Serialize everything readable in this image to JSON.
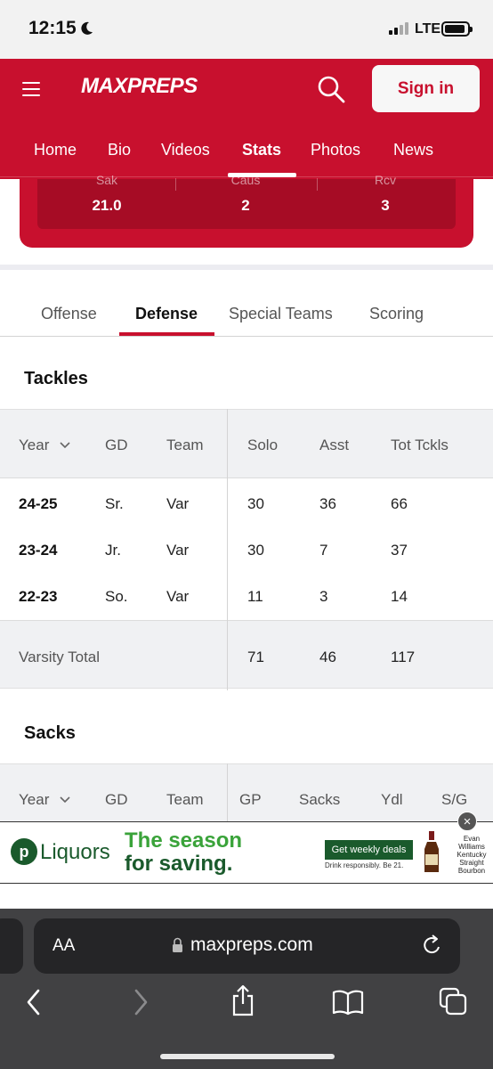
{
  "status_bar": {
    "time": "12:15",
    "network": "LTE"
  },
  "header": {
    "logo": "MAXPREPS",
    "signin_label": "Sign in",
    "nav": [
      "Home",
      "Bio",
      "Videos",
      "Stats",
      "Photos",
      "News"
    ],
    "active_nav": "Stats"
  },
  "summary": {
    "stats": [
      {
        "label": "Sak",
        "value": "21.0"
      },
      {
        "label": "Caus",
        "value": "2"
      },
      {
        "label": "Rcv",
        "value": "3"
      }
    ]
  },
  "subtabs": {
    "items": [
      "Offense",
      "Defense",
      "Special Teams",
      "Scoring"
    ],
    "active": "Defense"
  },
  "tackles": {
    "title": "Tackles",
    "columns": [
      "Year",
      "GD",
      "Team",
      "Solo",
      "Asst",
      "Tot Tckls"
    ],
    "rows": [
      [
        "24-25",
        "Sr.",
        "Var",
        "30",
        "36",
        "66"
      ],
      [
        "23-24",
        "Jr.",
        "Var",
        "30",
        "7",
        "37"
      ],
      [
        "22-23",
        "So.",
        "Var",
        "11",
        "3",
        "14"
      ]
    ],
    "total": {
      "label": "Varsity Total",
      "values": [
        "71",
        "46",
        "117"
      ]
    }
  },
  "sacks": {
    "title": "Sacks",
    "columns": [
      "Year",
      "GD",
      "Team",
      "GP",
      "Sacks",
      "Ydl",
      "S/G"
    ]
  },
  "ad": {
    "brand_initial": "p",
    "brand": "Liquors",
    "headline_1": "The season",
    "headline_2": "for saving.",
    "cta": "Get weekly deals",
    "fine_print": "Drink responsibly. Be 21.",
    "product": "Evan Williams Kentucky Straight Bourbon",
    "close": "×"
  },
  "browser": {
    "aa_label": "AA",
    "url": "maxpreps.com"
  }
}
